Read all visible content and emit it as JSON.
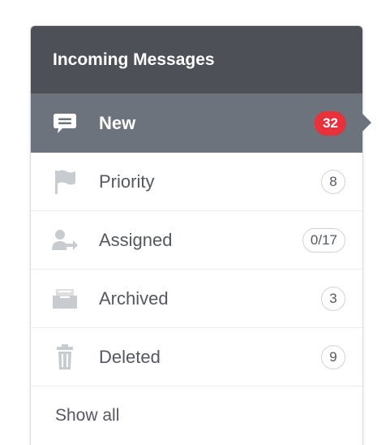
{
  "header": {
    "title": "Incoming Messages"
  },
  "items": [
    {
      "label": "New",
      "count": "32",
      "icon": "chat-bubble-icon",
      "active": true
    },
    {
      "label": "Priority",
      "count": "8",
      "icon": "flag-icon",
      "active": false
    },
    {
      "label": "Assigned",
      "count": "0/17",
      "icon": "assign-user-icon",
      "active": false
    },
    {
      "label": "Archived",
      "count": "3",
      "icon": "archive-box-icon",
      "active": false
    },
    {
      "label": "Deleted",
      "count": "9",
      "icon": "trash-icon",
      "active": false
    }
  ],
  "footer": {
    "show_all": "Show all"
  },
  "colors": {
    "header_bg": "#4d5057",
    "active_bg": "#6d737c",
    "badge_alert": "#e8313a",
    "icon_muted": "#c8cbd0"
  }
}
